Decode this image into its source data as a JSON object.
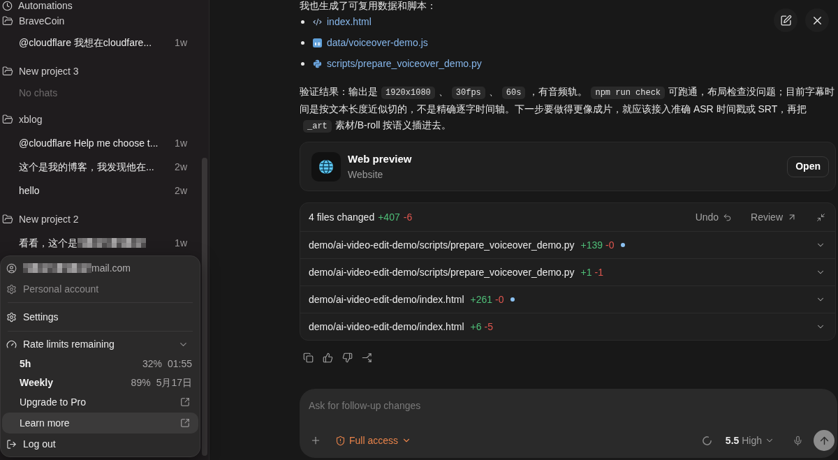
{
  "sidebar": {
    "nav_items": [
      {
        "label": "Automations"
      }
    ],
    "projects": [
      {
        "name": "BraveCoin",
        "chats": [
          {
            "title": "@cloudflare 我想在cloudfare...",
            "age": "1w",
            "redacted": false
          }
        ]
      },
      {
        "name": "New project 3",
        "empty_text": "No chats"
      },
      {
        "name": "xblog",
        "chats": [
          {
            "title": "@cloudflare Help me choose t...",
            "age": "1w",
            "redacted": false
          },
          {
            "title": "这个是我的博客，我发现他在...",
            "age": "2w",
            "redacted": false
          },
          {
            "title": "hello",
            "age": "2w",
            "redacted": false
          }
        ]
      },
      {
        "name": "New project 2",
        "chats": [
          {
            "title": "看看，这个是",
            "age": "1w",
            "redacted": true
          }
        ]
      }
    ]
  },
  "account_menu": {
    "account": {
      "email": "mail.com",
      "email_redacted": true,
      "workspace": "Personal account",
      "workspace_disabled": true
    },
    "settings": {
      "label": "Settings"
    },
    "rate_limits": {
      "label": "Rate limits remaining",
      "expanded": true,
      "limits": [
        {
          "window": "5h",
          "percent": "32%",
          "reset": "01:55"
        },
        {
          "window": "Weekly",
          "percent": "89%",
          "reset": "5月17日"
        }
      ]
    },
    "links": [
      {
        "label": "Upgrade to Pro",
        "highlighted": false
      },
      {
        "label": "Learn more",
        "highlighted": true
      }
    ],
    "logout": {
      "label": "Log out"
    }
  },
  "conversation": {
    "intro": "我也生成了可复用数据和脚本：",
    "files": [
      {
        "kind": "html",
        "name": "index.html"
      },
      {
        "kind": "js",
        "name": "data/voiceover-demo.js"
      },
      {
        "kind": "python",
        "name": "scripts/prepare_voiceover_demo.py"
      }
    ],
    "paragraph": [
      {
        "kind": "text",
        "text": "验证结果：输出是"
      },
      {
        "kind": "code",
        "text": "1920x1080"
      },
      {
        "kind": "text",
        "text": "、"
      },
      {
        "kind": "code",
        "text": "30fps"
      },
      {
        "kind": "text",
        "text": "、"
      },
      {
        "kind": "code",
        "text": "60s"
      },
      {
        "kind": "text",
        "text": "，有音频轨。"
      },
      {
        "kind": "code",
        "text": "npm run check"
      },
      {
        "kind": "text",
        "text": "可跑通，布局检查没问题；目前字幕时间是按文本长度近似切的，不是精确逐字时间轴。下一步要做得更像成片，就应该接入准确 ASR 时间戳或 SRT，再把"
      },
      {
        "kind": "code",
        "text": "_art"
      },
      {
        "kind": "text",
        "text": "素材/B-roll 按语义插进去。"
      }
    ],
    "preview_card": {
      "title": "Web preview",
      "subtitle": "Website",
      "button": "Open"
    },
    "changes": {
      "summary": "4 files changed",
      "added": "+407",
      "removed": "-6",
      "undo": "Undo",
      "review": "Review",
      "files": [
        {
          "path": "demo/ai-video-edit-demo/scripts/prepare_voiceover_demo.py",
          "added": "+139",
          "removed": "-0",
          "indicator_dot": true
        },
        {
          "path": "demo/ai-video-edit-demo/scripts/prepare_voiceover_demo.py",
          "added": "+1",
          "removed": "-1",
          "indicator_dot": false
        },
        {
          "path": "demo/ai-video-edit-demo/index.html",
          "added": "+261",
          "removed": "-0",
          "indicator_dot": true
        },
        {
          "path": "demo/ai-video-edit-demo/index.html",
          "added": "+6",
          "removed": "-5",
          "indicator_dot": false
        }
      ]
    }
  },
  "composer": {
    "placeholder": "Ask for follow-up changes",
    "access_mode": "Full access",
    "model": "5.5",
    "effort": "High"
  }
}
